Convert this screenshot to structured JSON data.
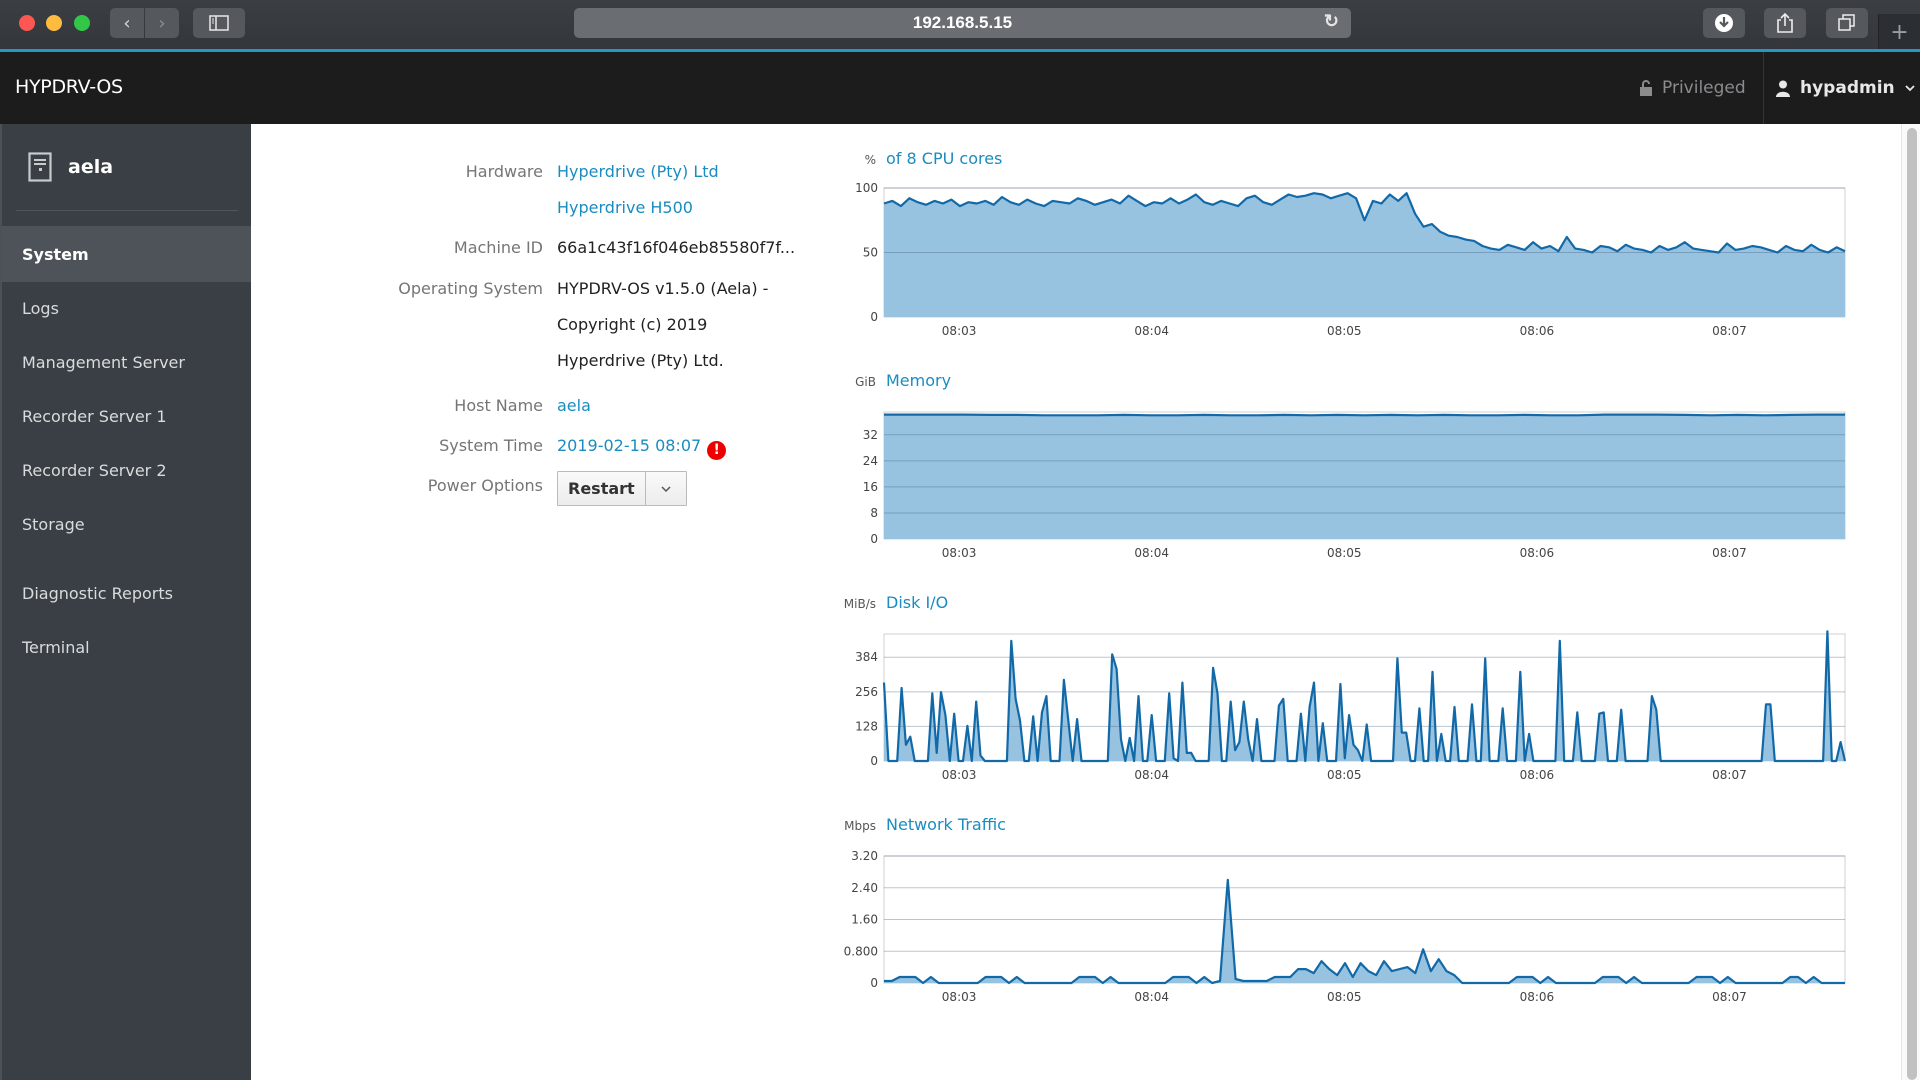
{
  "browser": {
    "url": "192.168.5.15",
    "buttons": {
      "back": "‹",
      "forward": "›",
      "sidebar_toggle": "sidebar-icon",
      "reload": "↻",
      "download": "download-icon",
      "share": "share-icon",
      "tabs": "tabs-icon",
      "new_tab": "+"
    }
  },
  "header": {
    "brand": "HYPDRV-OS",
    "privileged_label": "Privileged",
    "username": "hypadmin"
  },
  "sidebar": {
    "host": "aela",
    "items": [
      {
        "label": "System",
        "active": true
      },
      {
        "label": "Logs"
      },
      {
        "label": "Management Server"
      },
      {
        "label": "Recorder Server 1"
      },
      {
        "label": "Recorder Server 2"
      },
      {
        "label": "Storage"
      },
      {
        "label": "Diagnostic Reports"
      },
      {
        "label": "Terminal"
      }
    ]
  },
  "system_info": {
    "hardware_label": "Hardware",
    "hardware_vendor": "Hyperdrive (Pty) Ltd",
    "hardware_model": "Hyperdrive H500",
    "machine_id_label": "Machine ID",
    "machine_id": "66a1c43f16f046eb85580f7f...",
    "os_label": "Operating System",
    "os_line1": "HYPDRV-OS v1.5.0 (Aela) -",
    "os_line2": "Copyright (c) 2019",
    "os_line3": "Hyperdrive (Pty) Ltd.",
    "host_name_label": "Host Name",
    "host_name": "aela",
    "system_time_label": "System Time",
    "system_time": "2019-02-15 08:07",
    "system_time_warning": "!",
    "power_label": "Power Options",
    "power_button": "Restart",
    "power_caret": "⌄"
  },
  "colors": {
    "accent": "#1a8cc0",
    "line": "#1269a8",
    "fill": "#98c3e0",
    "warning": "#e00000"
  },
  "chart_data": [
    {
      "type": "area",
      "unit": "%",
      "title": "of 8 CPU cores",
      "x_ticks": [
        "08:03",
        "08:04",
        "08:05",
        "08:06",
        "08:07"
      ],
      "x_range_minutes": [
        -0.39,
        4.6
      ],
      "y_ticks": [
        0,
        50,
        100
      ],
      "ylim": [
        0,
        100
      ],
      "grid": true,
      "values": [
        88,
        90,
        86,
        92,
        89,
        87,
        90,
        88,
        91,
        86,
        89,
        88,
        90,
        87,
        93,
        89,
        87,
        91,
        88,
        86,
        90,
        89,
        88,
        92,
        90,
        87,
        89,
        91,
        88,
        94,
        90,
        86,
        89,
        88,
        92,
        88,
        91,
        95,
        89,
        87,
        90,
        88,
        86,
        92,
        94,
        89,
        87,
        91,
        95,
        93,
        94,
        96,
        95,
        92,
        94,
        96,
        92,
        75,
        90,
        88,
        95,
        90,
        96,
        80,
        70,
        72,
        66,
        63,
        62,
        60,
        59,
        55,
        53,
        52,
        56,
        54,
        52,
        58,
        53,
        55,
        51,
        62,
        53,
        52,
        50,
        55,
        54,
        51,
        56,
        53,
        52,
        50,
        55,
        52,
        54,
        58,
        53,
        52,
        51,
        50,
        57,
        52,
        53,
        55,
        54,
        52,
        50,
        55,
        52,
        51,
        56,
        52,
        50,
        54,
        51
      ]
    },
    {
      "type": "area",
      "unit": "GiB",
      "title": "Memory",
      "x_ticks": [
        "08:03",
        "08:04",
        "08:05",
        "08:06",
        "08:07"
      ],
      "x_range_minutes": [
        -0.39,
        4.6
      ],
      "y_ticks": [
        0,
        8,
        16,
        24,
        32
      ],
      "ylim": [
        0,
        39
      ],
      "grid": true,
      "values": [
        38.2,
        38.2,
        38.2,
        38.2,
        38.1,
        38.1,
        38.0,
        38.0,
        38.0,
        38.1,
        38.0,
        38.0,
        38.1,
        38.0,
        38.0,
        38.1,
        38.0,
        38.1,
        38.0,
        38.1,
        38.0,
        38.1,
        38.0,
        38.0,
        38.1,
        38.0,
        38.0,
        38.2,
        38.2,
        38.2,
        38.1,
        38.0,
        38.1,
        38.0,
        38.1,
        38.2,
        38.2
      ]
    },
    {
      "type": "area",
      "unit": "MiB/s",
      "title": "Disk I/O",
      "x_ticks": [
        "08:03",
        "08:04",
        "08:05",
        "08:06",
        "08:07"
      ],
      "x_range_minutes": [
        -0.39,
        4.6
      ],
      "y_ticks": [
        0,
        128,
        256,
        384
      ],
      "ylim": [
        0,
        470
      ],
      "grid": true,
      "values": [
        290,
        0,
        0,
        0,
        270,
        60,
        90,
        0,
        0,
        0,
        0,
        250,
        30,
        255,
        170,
        0,
        175,
        0,
        0,
        130,
        0,
        220,
        20,
        0,
        0,
        0,
        0,
        0,
        0,
        445,
        230,
        150,
        0,
        0,
        165,
        0,
        180,
        240,
        0,
        0,
        0,
        300,
        150,
        0,
        155,
        0,
        0,
        0,
        0,
        0,
        0,
        0,
        395,
        340,
        80,
        0,
        85,
        0,
        240,
        0,
        0,
        170,
        0,
        0,
        0,
        250,
        10,
        0,
        290,
        30,
        30,
        0,
        0,
        0,
        0,
        345,
        250,
        0,
        0,
        220,
        40,
        70,
        220,
        80,
        0,
        155,
        0,
        0,
        0,
        0,
        205,
        230,
        0,
        0,
        0,
        175,
        0,
        200,
        290,
        0,
        140,
        0,
        0,
        0,
        285,
        10,
        170,
        60,
        40,
        0,
        135,
        0,
        0,
        0,
        0,
        0,
        0,
        380,
        105,
        105,
        0,
        0,
        195,
        0,
        0,
        330,
        0,
        100,
        0,
        0,
        200,
        0,
        0,
        0,
        210,
        0,
        0,
        380,
        0,
        0,
        0,
        195,
        0,
        0,
        0,
        330,
        0,
        100,
        0,
        0,
        0,
        0,
        0,
        0,
        445,
        0,
        0,
        0,
        180,
        0,
        0,
        0,
        0,
        175,
        180,
        0,
        0,
        0,
        190,
        0,
        0,
        0,
        0,
        0,
        0,
        240,
        190,
        0,
        0,
        0,
        0,
        0,
        0,
        0,
        0,
        0,
        0,
        0,
        0,
        0,
        0,
        0,
        0,
        0,
        0,
        0,
        0,
        0,
        0,
        0,
        0,
        210,
        210,
        0,
        0,
        0,
        0,
        0,
        0,
        0,
        0,
        0,
        0,
        0,
        0,
        480,
        0,
        0,
        70,
        0
      ]
    },
    {
      "type": "area",
      "unit": "Mbps",
      "title": "Network Traffic",
      "x_ticks": [
        "08:03",
        "08:04",
        "08:05",
        "08:06",
        "08:07"
      ],
      "x_range_minutes": [
        -0.39,
        4.6
      ],
      "y_ticks": [
        "0",
        "0.800",
        "1.60",
        "2.40",
        "3.20"
      ],
      "ylim": [
        0,
        3.2
      ],
      "grid": true,
      "values": [
        0.05,
        0.05,
        0.15,
        0.15,
        0.15,
        0.0,
        0.15,
        0.0,
        0.0,
        0.0,
        0.0,
        0.0,
        0.0,
        0.15,
        0.15,
        0.15,
        0.0,
        0.15,
        0.0,
        0.0,
        0.0,
        0.0,
        0.0,
        0.0,
        0.0,
        0.15,
        0.15,
        0.15,
        0.0,
        0.15,
        0.0,
        0.0,
        0.0,
        0.0,
        0.0,
        0.0,
        0.0,
        0.15,
        0.15,
        0.15,
        0.0,
        0.15,
        0.0,
        0.05,
        2.6,
        0.1,
        0.05,
        0.05,
        0.05,
        0.05,
        0.15,
        0.15,
        0.15,
        0.35,
        0.35,
        0.25,
        0.55,
        0.35,
        0.2,
        0.5,
        0.15,
        0.5,
        0.3,
        0.2,
        0.55,
        0.3,
        0.35,
        0.4,
        0.25,
        0.85,
        0.3,
        0.6,
        0.3,
        0.2,
        0.0,
        0.0,
        0.0,
        0.0,
        0.0,
        0.0,
        0.0,
        0.15,
        0.15,
        0.15,
        0.0,
        0.15,
        0.0,
        0.0,
        0.0,
        0.0,
        0.0,
        0.0,
        0.15,
        0.15,
        0.15,
        0.0,
        0.15,
        0.0,
        0.0,
        0.0,
        0.0,
        0.0,
        0.0,
        0.0,
        0.15,
        0.15,
        0.15,
        0.0,
        0.15,
        0.0,
        0.0,
        0.0,
        0.0,
        0.0,
        0.0,
        0.0,
        0.15,
        0.15,
        0.0,
        0.15,
        0.0,
        0.0,
        0.0,
        0.0
      ]
    }
  ]
}
